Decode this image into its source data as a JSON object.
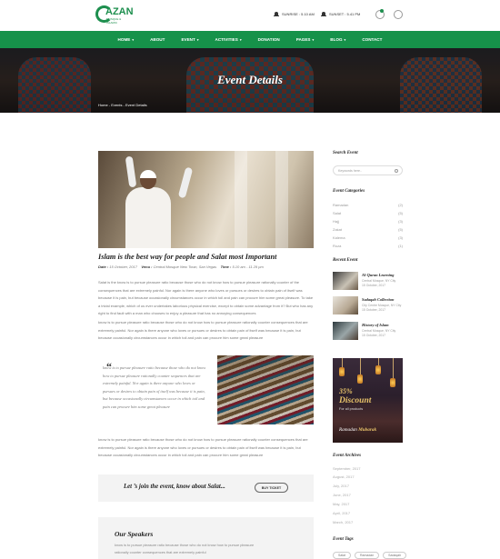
{
  "header": {
    "logo_text": "AZAN",
    "logo_sub": "MOSQUE & ISLAMIC",
    "sunrise": "SUNRISE : 5.10 AM",
    "sunset": "SUNSET : 5.41 PM"
  },
  "nav": {
    "items": [
      {
        "label": "HOME",
        "dropdown": "▾"
      },
      {
        "label": "ABOUT",
        "dropdown": ""
      },
      {
        "label": "EVENT",
        "dropdown": "▾"
      },
      {
        "label": "ACTIVITIES",
        "dropdown": "▾"
      },
      {
        "label": "DONATION",
        "dropdown": ""
      },
      {
        "label": "PAGES",
        "dropdown": "▾"
      },
      {
        "label": "BLOG",
        "dropdown": "▾"
      },
      {
        "label": "CONTACT",
        "dropdown": ""
      }
    ]
  },
  "hero": {
    "title": "Event Details",
    "breadcrumb": "Home - Events - Event Details"
  },
  "post": {
    "title": "Islam is the best way for people and Salat most Important",
    "date_label": "Date :",
    "date_value": "15 October, 2017",
    "venue_label": "Venu :",
    "venue_value": "Central Mosque New Town, San Vegas",
    "time_label": "Time :",
    "time_value": "5.10 am - 11.29 pm",
    "para1": "Salat is the know is to pursue pleasure ratio because those who do not know how to pursue pleasure rationally counter of the consequences that are extremely painful. Nor again is there anyone who loves or pursues or desires to obtain pain of itself was because it is pain, but because occasionally circumstances occur in which toil and pain can procure him some great pleasure. To take a trivial example, which of us ever undertakes laborious physical exercise, except to obtain some advantage from it? But who has any right to find fault with a man who chooses to enjoy a pleasure that has no annoying consequences",
    "para2": "know is to pursue pleasure ratio because those who do not know how to pursue pleasure rationally counter consequences that are extremely painful. Nor again is there anyone who loves or pursues or desires to obtain pain of itself was because it is pain, but because occasionally circumstances occur in which toil and pain can procure him some great pleasure",
    "quote": "know is to pursue pleasure ratio because those who do not know how to pursue pleasure rationally counter sequences that are extremely painful. Nor again is there anyone who loves or pursues or desires to obtain pain of itself was because it is pain, but because occasionally circumstances occur in which toil and pain can procure him some great pleasure",
    "para3": "know is to pursue pleasure ratio because those who do not know how to pursue pleasure rationally counter consequences that are extremely painful. Nor again is there anyone who loves or pursues or desires to obtain pain of itself was because it is pain, but because occasionally circumstances occur in which toil and pain can procure him some great pleasure"
  },
  "cta": {
    "text": "Let ’s join the event, know about Salat...",
    "button": "BUY TICKET"
  },
  "speakers": {
    "title": "Our Speakers",
    "text": "know is to pursue pleasure ratio because those who do not know how to pursue pleasure rationally counter consequences that are extremely painful"
  },
  "sidebar": {
    "search_title": "Search Event",
    "search_placeholder": "Keywords here..",
    "categories_title": "Event Categories",
    "categories": [
      {
        "name": "Ramadan",
        "count": "(2)"
      },
      {
        "name": "Salat",
        "count": "(5)"
      },
      {
        "name": "Hajj",
        "count": "(3)"
      },
      {
        "name": "Zakat",
        "count": "(5)"
      },
      {
        "name": "Kalema",
        "count": "(3)"
      },
      {
        "name": "Roza",
        "count": "(1)"
      }
    ],
    "recent_title": "Recent Event",
    "recent": [
      {
        "title": "Al-Quran Learning",
        "loc": "Central Mosque, NY City",
        "date": "15 October, 2017"
      },
      {
        "title": "Sadaqah Collection",
        "loc": "City Centre Mosque, NY City",
        "date": "15 October, 2017"
      },
      {
        "title": "History of Islam",
        "loc": "Central Mosque, NY City",
        "date": "15 October, 2017"
      }
    ],
    "ad": {
      "percent": "35%",
      "discount": "Discount",
      "for": "For all products",
      "ramadan": "Ramadan",
      "mubarak": "Mubarak"
    },
    "archives_title": "Event Archives",
    "archives": [
      "September, 2017",
      "August, 2017",
      "July, 2017",
      "June, 2017",
      "May, 2017",
      "April, 2017",
      "March, 2017"
    ],
    "tags_title": "Event Tags",
    "tags": [
      "Salat",
      "Ramadan",
      "Sadaqah"
    ]
  }
}
